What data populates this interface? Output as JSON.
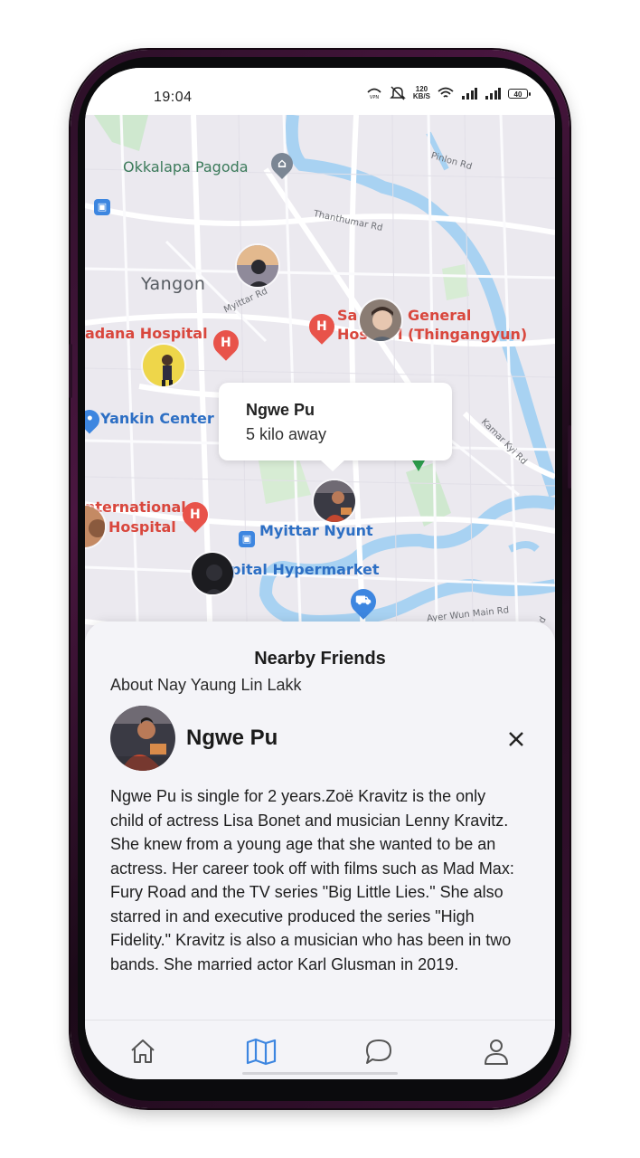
{
  "status_bar": {
    "time": "19:04",
    "net_speed_value": "120",
    "net_speed_unit": "KB/S",
    "battery": "40",
    "icons": [
      "vpn-icon",
      "mute-icon",
      "wifi-icon",
      "signal-icon",
      "signal-icon",
      "battery-icon"
    ]
  },
  "map": {
    "labels": {
      "okkalapa_pagoda": "Okkalapa Pagoda",
      "yangon": "Yangon",
      "pinlon_rd": "Pinlon Rd",
      "thanthumar_rd": "Thanthumar Rd",
      "myittar_rd": "Myittar Rd",
      "hospital_left": "adana Hospital",
      "general_hospital_1": "Sa",
      "general_hospital_1b": "General",
      "general_hospital_2": "Hos",
      "general_hospital_2b": "l (Thingangyun)",
      "yankin_center": "Yankin Center",
      "kamar_kyi_rd": "Kamar Kyi Rd",
      "international_1": "nternational",
      "international_2": "Hospital",
      "myittar_nyunt": "Myittar Nyunt",
      "hypermarket": "pital Hypermarket",
      "ayer_wun_main_rd": "Ayer Wun Main Rd",
      "pa": "Pa",
      "rd_edge": "Rd"
    },
    "tooltip": {
      "name": "Ngwe Pu",
      "distance": "5 kilo away"
    }
  },
  "sheet": {
    "title": "Nearby Friends",
    "subtitle": "About Nay Yaung Lin Lakk",
    "profile_name": "Ngwe Pu",
    "close_icon": "close-icon",
    "bio": "Ngwe Pu is single for 2 years.Zoë Kravitz is the only child of actress Lisa Bonet and musician Lenny Kravitz. She knew from a young age that she wanted to be an actress. Her career took off with films such as Mad Max: Fury Road and the TV series \"Big Little Lies.\" She also starred in and executive produced the series \"High Fidelity.\" Kravitz is also a musician who has been in two bands. She married actor Karl Glusman in 2019."
  },
  "nav": {
    "items": [
      "home-icon",
      "map-icon",
      "chat-icon",
      "profile-icon"
    ],
    "active": "map-icon",
    "active_color": "#3d86e0",
    "inactive_color": "#555555"
  }
}
